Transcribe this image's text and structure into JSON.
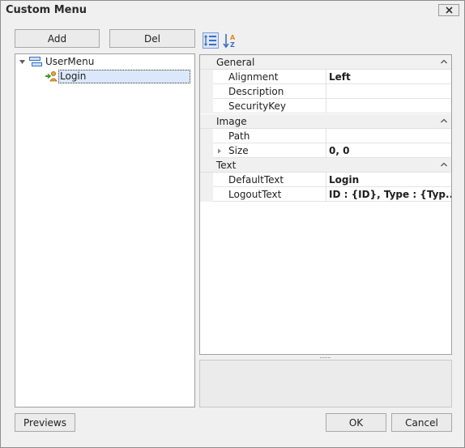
{
  "window": {
    "title": "Custom Menu"
  },
  "toolbar": {
    "add_label": "Add",
    "del_label": "Del"
  },
  "tree": {
    "root": {
      "label": "UserMenu",
      "expanded": true
    },
    "child": {
      "label": "Login",
      "selected": true
    }
  },
  "grid": {
    "categories": [
      {
        "name": "General",
        "properties": [
          {
            "name": "Alignment",
            "value": "Left"
          },
          {
            "name": "Description",
            "value": ""
          },
          {
            "name": "SecurityKey",
            "value": ""
          }
        ]
      },
      {
        "name": "Image",
        "properties": [
          {
            "name": "Path",
            "value": ""
          },
          {
            "name": "Size",
            "value": "0, 0",
            "expandable": true
          }
        ]
      },
      {
        "name": "Text",
        "properties": [
          {
            "name": "DefaultText",
            "value": "Login"
          },
          {
            "name": "LogoutText",
            "value": "ID : {ID}, Type : {Typ..."
          }
        ]
      }
    ]
  },
  "footer": {
    "previews_label": "Previews",
    "ok_label": "OK",
    "cancel_label": "Cancel"
  },
  "colors": {
    "selection": "#dbe8fb",
    "category_bg": "#f0f0f0",
    "accent_blue": "#3a6fc4",
    "accent_orange": "#e08a1e"
  }
}
